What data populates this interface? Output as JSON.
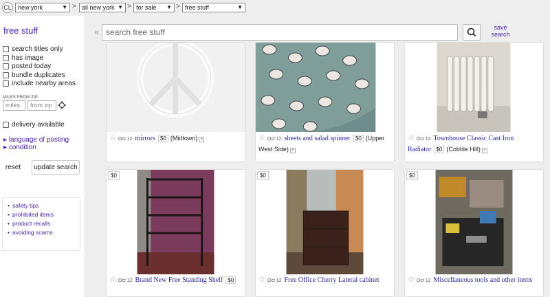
{
  "topbar": {
    "logo": "CL",
    "crumbs": [
      "new york",
      "all new york",
      "for sale",
      "free stuff"
    ],
    "separator": ">"
  },
  "sidebar": {
    "title": "free stuff",
    "checkboxes": [
      "search titles only",
      "has image",
      "posted today",
      "bundle duplicates",
      "include nearby areas"
    ],
    "miles_label": "MILES FROM ZIP",
    "miles_placeholder": "miles",
    "zip_placeholder": "from zip",
    "delivery": "delivery available",
    "links": [
      "language of posting",
      "condition"
    ],
    "reset_label": "reset",
    "update_label": "update search",
    "tips": [
      "safety tips",
      "prohibited items",
      "product recalls",
      "avoiding scams"
    ]
  },
  "search": {
    "placeholder": "search free stuff",
    "save_line1": "save",
    "save_line2": "search"
  },
  "listings": [
    {
      "date": "Oct 12",
      "title": "mirrors",
      "price": "$0",
      "hood": "(Midtown)"
    },
    {
      "date": "Oct 12",
      "title": "sheets and salad spinner",
      "price": "$0",
      "hood": "(Upper",
      "hood2": "West Side)"
    },
    {
      "date": "Oct 12",
      "title": "Townhouse Classic Cast Iron",
      "title2": "Radiator",
      "price": "$0",
      "hood": "(Cobble Hill)"
    },
    {
      "date": "Oct 12",
      "title": "Brand New Free Standing Shelf",
      "price": "$0",
      "badge": "$0"
    },
    {
      "date": "Oct 12",
      "title": "Free Office Cherry Lateral cabinet",
      "price": "",
      "badge": "$0"
    },
    {
      "date": "Oct 12",
      "title": "Miscellaneous tools and other items",
      "price": "",
      "badge": "$0"
    }
  ],
  "colors": {
    "link": "#4a22a8",
    "title": "#2a2a9a"
  }
}
